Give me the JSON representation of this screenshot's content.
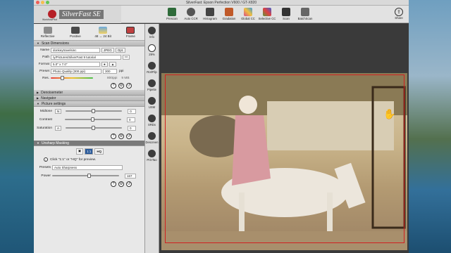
{
  "window": {
    "title": "SilverFast: Epson Perfection V600 / GT-X820"
  },
  "app": {
    "logo": "SilverFast SE",
    "logo_sub": "WorkflowPilot"
  },
  "toolbar": {
    "buttons": [
      {
        "label": "Prescan",
        "icon": "prescan-icon",
        "color": "#2e6b3a"
      },
      {
        "label": "Auto CCR",
        "icon": "auto-ccr-icon",
        "color": "#555555"
      },
      {
        "label": "Histogram",
        "icon": "histogram-icon",
        "color": "#444444"
      },
      {
        "label": "Gradation",
        "icon": "gradation-icon",
        "color": "#c05a2a"
      },
      {
        "label": "Global CC",
        "icon": "global-cc-icon",
        "color": "#d84a8a"
      },
      {
        "label": "Selective CC",
        "icon": "selective-cc-icon",
        "color": "#5a9a3a"
      },
      {
        "label": "Scan",
        "icon": "scan-icon",
        "color": "#333333"
      },
      {
        "label": "BatchScan",
        "icon": "batchscan-icon",
        "color": "#666666"
      }
    ],
    "share": "Share"
  },
  "modes": [
    {
      "label": "Reflective"
    },
    {
      "label": "Positive"
    },
    {
      "label": "48 → 24 Bit"
    },
    {
      "label": "Frame"
    }
  ],
  "scan_dimensions": {
    "title": "Scan Dimensions",
    "name_label": "Name",
    "name_value": "donkeytravelsinc",
    "format_type": "JPEG",
    "opt": "Opt.",
    "path_label": "Path",
    "path_value": "/y/Pictures/SilverFast 9 tutorial",
    "format_label": "Format",
    "format_value": "5.0\" x 7.0\"",
    "preset_label": "Preset",
    "preset_value": "Photo Quality (300 ppi)",
    "ppi_value": "300",
    "ppi_unit": "ppi",
    "res_label": "Res.",
    "res_value": "800ppi",
    "size_value": "9 MB",
    "res_level": 0.28
  },
  "sections": {
    "denoise": "Denoisemeter",
    "navigator": "Navigator",
    "picture": "Picture settings",
    "usm": "Unsharp Masking"
  },
  "picture": {
    "midtone_label": "Midtone",
    "midtone_value": "0",
    "midtone_box": "N",
    "midtone_level": 0.5,
    "contrast_label": "Contrast",
    "contrast_value": "0",
    "contrast_level": 0.5,
    "saturation_label": "Saturation",
    "saturation_value": "0",
    "saturation_box": "A",
    "saturation_level": 0.5
  },
  "usm": {
    "view_buttons": [
      "1:1",
      "HQ"
    ],
    "hint": "Click \"1:1\" or \"HQ\" for preview.",
    "presets_label": "Presets",
    "presets_value": "Auto Sharpness",
    "power_label": "Power",
    "power_value": "167",
    "power_level": 0.56
  },
  "vtools": [
    {
      "label": "Info",
      "icon": "info-icon"
    },
    {
      "label": "29%",
      "icon": "zoom-icon"
    },
    {
      "label": "Rot/Flip",
      "icon": "rotate-icon"
    },
    {
      "label": "Pipette",
      "icon": "pipette-icon"
    },
    {
      "label": "USM",
      "icon": "usm-icon"
    },
    {
      "label": "SRDx",
      "icon": "srdx-icon"
    },
    {
      "label": "Descreen",
      "icon": "descreen-icon"
    },
    {
      "label": "PrinTao",
      "icon": "printao-icon"
    }
  ]
}
